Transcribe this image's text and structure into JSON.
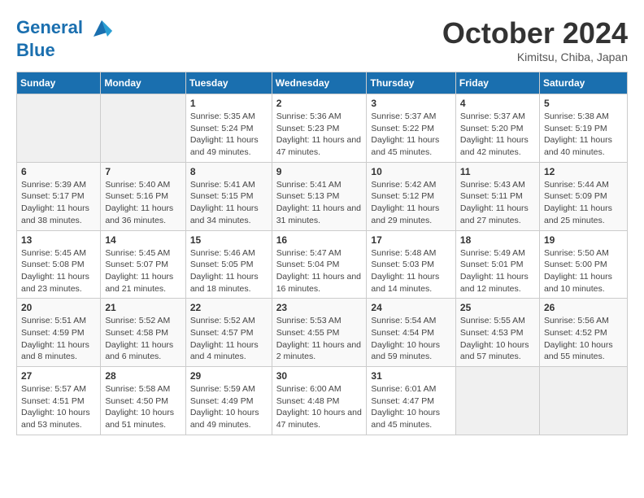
{
  "header": {
    "logo_line1": "General",
    "logo_line2": "Blue",
    "month": "October 2024",
    "location": "Kimitsu, Chiba, Japan"
  },
  "weekdays": [
    "Sunday",
    "Monday",
    "Tuesday",
    "Wednesday",
    "Thursday",
    "Friday",
    "Saturday"
  ],
  "weeks": [
    [
      {
        "day": "",
        "info": ""
      },
      {
        "day": "",
        "info": ""
      },
      {
        "day": "1",
        "info": "Sunrise: 5:35 AM\nSunset: 5:24 PM\nDaylight: 11 hours and 49 minutes."
      },
      {
        "day": "2",
        "info": "Sunrise: 5:36 AM\nSunset: 5:23 PM\nDaylight: 11 hours and 47 minutes."
      },
      {
        "day": "3",
        "info": "Sunrise: 5:37 AM\nSunset: 5:22 PM\nDaylight: 11 hours and 45 minutes."
      },
      {
        "day": "4",
        "info": "Sunrise: 5:37 AM\nSunset: 5:20 PM\nDaylight: 11 hours and 42 minutes."
      },
      {
        "day": "5",
        "info": "Sunrise: 5:38 AM\nSunset: 5:19 PM\nDaylight: 11 hours and 40 minutes."
      }
    ],
    [
      {
        "day": "6",
        "info": "Sunrise: 5:39 AM\nSunset: 5:17 PM\nDaylight: 11 hours and 38 minutes."
      },
      {
        "day": "7",
        "info": "Sunrise: 5:40 AM\nSunset: 5:16 PM\nDaylight: 11 hours and 36 minutes."
      },
      {
        "day": "8",
        "info": "Sunrise: 5:41 AM\nSunset: 5:15 PM\nDaylight: 11 hours and 34 minutes."
      },
      {
        "day": "9",
        "info": "Sunrise: 5:41 AM\nSunset: 5:13 PM\nDaylight: 11 hours and 31 minutes."
      },
      {
        "day": "10",
        "info": "Sunrise: 5:42 AM\nSunset: 5:12 PM\nDaylight: 11 hours and 29 minutes."
      },
      {
        "day": "11",
        "info": "Sunrise: 5:43 AM\nSunset: 5:11 PM\nDaylight: 11 hours and 27 minutes."
      },
      {
        "day": "12",
        "info": "Sunrise: 5:44 AM\nSunset: 5:09 PM\nDaylight: 11 hours and 25 minutes."
      }
    ],
    [
      {
        "day": "13",
        "info": "Sunrise: 5:45 AM\nSunset: 5:08 PM\nDaylight: 11 hours and 23 minutes."
      },
      {
        "day": "14",
        "info": "Sunrise: 5:45 AM\nSunset: 5:07 PM\nDaylight: 11 hours and 21 minutes."
      },
      {
        "day": "15",
        "info": "Sunrise: 5:46 AM\nSunset: 5:05 PM\nDaylight: 11 hours and 18 minutes."
      },
      {
        "day": "16",
        "info": "Sunrise: 5:47 AM\nSunset: 5:04 PM\nDaylight: 11 hours and 16 minutes."
      },
      {
        "day": "17",
        "info": "Sunrise: 5:48 AM\nSunset: 5:03 PM\nDaylight: 11 hours and 14 minutes."
      },
      {
        "day": "18",
        "info": "Sunrise: 5:49 AM\nSunset: 5:01 PM\nDaylight: 11 hours and 12 minutes."
      },
      {
        "day": "19",
        "info": "Sunrise: 5:50 AM\nSunset: 5:00 PM\nDaylight: 11 hours and 10 minutes."
      }
    ],
    [
      {
        "day": "20",
        "info": "Sunrise: 5:51 AM\nSunset: 4:59 PM\nDaylight: 11 hours and 8 minutes."
      },
      {
        "day": "21",
        "info": "Sunrise: 5:52 AM\nSunset: 4:58 PM\nDaylight: 11 hours and 6 minutes."
      },
      {
        "day": "22",
        "info": "Sunrise: 5:52 AM\nSunset: 4:57 PM\nDaylight: 11 hours and 4 minutes."
      },
      {
        "day": "23",
        "info": "Sunrise: 5:53 AM\nSunset: 4:55 PM\nDaylight: 11 hours and 2 minutes."
      },
      {
        "day": "24",
        "info": "Sunrise: 5:54 AM\nSunset: 4:54 PM\nDaylight: 10 hours and 59 minutes."
      },
      {
        "day": "25",
        "info": "Sunrise: 5:55 AM\nSunset: 4:53 PM\nDaylight: 10 hours and 57 minutes."
      },
      {
        "day": "26",
        "info": "Sunrise: 5:56 AM\nSunset: 4:52 PM\nDaylight: 10 hours and 55 minutes."
      }
    ],
    [
      {
        "day": "27",
        "info": "Sunrise: 5:57 AM\nSunset: 4:51 PM\nDaylight: 10 hours and 53 minutes."
      },
      {
        "day": "28",
        "info": "Sunrise: 5:58 AM\nSunset: 4:50 PM\nDaylight: 10 hours and 51 minutes."
      },
      {
        "day": "29",
        "info": "Sunrise: 5:59 AM\nSunset: 4:49 PM\nDaylight: 10 hours and 49 minutes."
      },
      {
        "day": "30",
        "info": "Sunrise: 6:00 AM\nSunset: 4:48 PM\nDaylight: 10 hours and 47 minutes."
      },
      {
        "day": "31",
        "info": "Sunrise: 6:01 AM\nSunset: 4:47 PM\nDaylight: 10 hours and 45 minutes."
      },
      {
        "day": "",
        "info": ""
      },
      {
        "day": "",
        "info": ""
      }
    ]
  ]
}
